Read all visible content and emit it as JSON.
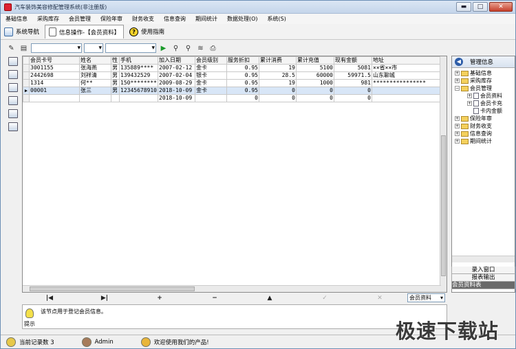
{
  "window": {
    "title": "汽车装饰美容修配管理系统(非注册版)",
    "btn_min": "▬",
    "btn_max": "□",
    "btn_close": "✕"
  },
  "menu": [
    "基础信息",
    "采购库存",
    "会员管理",
    "保险年审",
    "财务收支",
    "信息查询",
    "期间统计",
    "数据处理(O)",
    "系统(S)"
  ],
  "navtabs": {
    "nav": "系统导航",
    "info": "信息操作-【会员资料】",
    "help": "使用指南"
  },
  "grid": {
    "columns": [
      "会员卡号",
      "姓名",
      "性",
      "手机",
      "加入日期",
      "会员级别",
      "服务折扣",
      "累计消费",
      "累计充值",
      "现有金额",
      "地址"
    ],
    "rows": [
      [
        "3001155",
        "张海燕",
        "男",
        "135889****",
        "2007-02-12",
        "金卡",
        "0.95",
        "19",
        "5100",
        "5081",
        "××省××市"
      ],
      [
        "2442698",
        "刘祥清",
        "男",
        "139432529",
        "2007-02-04",
        "银卡",
        "0.95",
        "28.5",
        "60000",
        "59971.5",
        "山东聊城"
      ],
      [
        "1314",
        "何**",
        "男",
        "150********",
        "2009-08-29",
        "金卡",
        "0.95",
        "19",
        "1000",
        "981",
        "****************"
      ],
      [
        "00001",
        "张三",
        "男",
        "12345678910",
        "2018-10-09",
        "金卡",
        "0.95",
        "0",
        "0",
        "0",
        ""
      ],
      [
        "",
        "",
        "",
        "",
        "2018-10-09",
        "",
        "0",
        "0",
        "0",
        "0",
        ""
      ]
    ]
  },
  "gridnav": {
    "first": "|◀",
    "prev": "▶|",
    "add": "+",
    "remove": "−",
    "up": "▲",
    "confirm": "✓",
    "cancel": "✕",
    "select_value": "会员资料"
  },
  "hint": {
    "text": "该节点用于登记会员信息。",
    "label": "提示"
  },
  "rightpanel": {
    "title": "管理信息",
    "tree": [
      {
        "label": "基础信息",
        "level": 0,
        "kind": "folder",
        "pm": "+"
      },
      {
        "label": "采购库存",
        "level": 0,
        "kind": "folder",
        "pm": "+"
      },
      {
        "label": "会员管理",
        "level": 0,
        "kind": "folder",
        "pm": "−"
      },
      {
        "label": "会员资料",
        "level": 1,
        "kind": "page",
        "pm": "+"
      },
      {
        "label": "会员卡充",
        "level": 1,
        "kind": "page",
        "pm": "+"
      },
      {
        "label": "卡内金额",
        "level": 1,
        "kind": "page",
        "pm": ""
      },
      {
        "label": "保险年审",
        "level": 0,
        "kind": "folder",
        "pm": "+"
      },
      {
        "label": "财务收支",
        "level": 0,
        "kind": "folder",
        "pm": "+"
      },
      {
        "label": "信息查询",
        "level": 0,
        "kind": "folder",
        "pm": "+"
      },
      {
        "label": "期间统计",
        "level": 0,
        "kind": "folder",
        "pm": "+"
      }
    ],
    "list": [
      "录入窗口",
      "报表输出",
      "会员资料表"
    ]
  },
  "status": {
    "records": "当前记录数 3",
    "user": "Admin",
    "welcome": "欢迎使用我们的产品!"
  },
  "watermark": "极速下载站"
}
